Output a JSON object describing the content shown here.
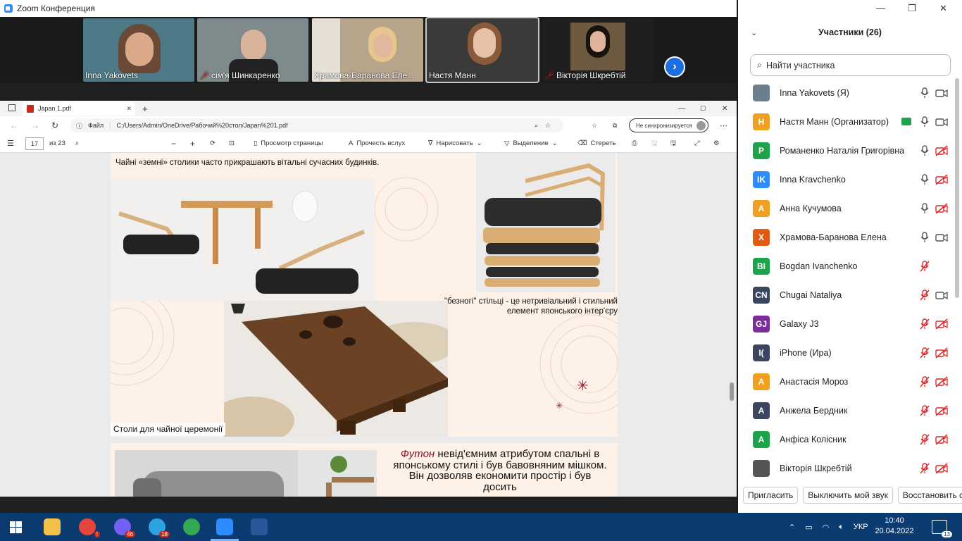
{
  "zoom_window": {
    "title": "Zoom Конференция"
  },
  "video_tiles": [
    {
      "name": "Inna Yakovets",
      "muted": false,
      "bg": "#4d7a86"
    },
    {
      "name": "сім'я Шинкаренко",
      "muted": true,
      "bg": "#7f8a8c"
    },
    {
      "name": "Храмова-Баранова Еле...",
      "muted": false,
      "bg": "#b7a58b"
    },
    {
      "name": "Настя Манн",
      "muted": false,
      "bg": "#3b3a38"
    },
    {
      "name": "Вікторія Шкребтій",
      "muted": true,
      "bg": "#1f1f1f"
    }
  ],
  "browser": {
    "tab_title": "Japan 1.pdf",
    "address_label": "Файл",
    "address": "C:/Users/Admin/OneDrive/Рабочий%20стол/Japan%201.pdf",
    "sync_label": "Не синхронизируется",
    "toolbar": {
      "page_current": "17",
      "page_total": "из 23",
      "page_view": "Просмотр страницы",
      "read_aloud": "Прочесть вслух",
      "draw": "Нарисовать",
      "highlight": "Выделение",
      "erase": "Стереть"
    }
  },
  "pdf": {
    "caption_top": "Чайні «земні» столики часто прикрашають вітальні сучасних будинків.",
    "caption_right": "\"безногі\" стільці - це нетривіальний і стильний елемент японського інтер'єру",
    "caption_bottom": "Столи для чайної церемонії",
    "futon_word": "Футон",
    "futon_text": " невід'ємним атрибутом спальні в японському стилі і був бавовняним мішком. Він дозволяв економити простір і був досить"
  },
  "participants_panel": {
    "title": "Участники (26)",
    "search_placeholder": "Найти участника",
    "participants": [
      {
        "initials": "",
        "name": "Inna Yakovets (Я)",
        "color": "#6d7f8c",
        "mic": "on",
        "cam": "on"
      },
      {
        "initials": "Н",
        "name": "Настя Манн (Организатор)",
        "color": "#f0a020",
        "mic": "on",
        "cam": "on"
      },
      {
        "initials": "Р",
        "name": "Романенко Наталія Григорівна",
        "color": "#1da34b",
        "mic": "on",
        "cam": "off"
      },
      {
        "initials": "IK",
        "name": "Inna Kravchenko",
        "color": "#2d8cff",
        "mic": "on",
        "cam": "off"
      },
      {
        "initials": "А",
        "name": "Анна Кучумова",
        "color": "#f0a020",
        "mic": "on",
        "cam": "off"
      },
      {
        "initials": "Х",
        "name": "Храмова-Баранова Елена",
        "color": "#e05a10",
        "mic": "on",
        "cam": "on"
      },
      {
        "initials": "BI",
        "name": "Bogdan Ivanchenko",
        "color": "#1da34b",
        "mic": "off",
        "cam": "none"
      },
      {
        "initials": "CN",
        "name": "Chugai Nataliya",
        "color": "#3a4660",
        "mic": "off",
        "cam": "on"
      },
      {
        "initials": "GJ",
        "name": "Galaxy J3",
        "color": "#7a2e9a",
        "mic": "off",
        "cam": "off"
      },
      {
        "initials": "I(",
        "name": "iPhone (Ира)",
        "color": "#3a4660",
        "mic": "off",
        "cam": "off"
      },
      {
        "initials": "А",
        "name": "Анастасія Мороз",
        "color": "#f0a020",
        "mic": "off",
        "cam": "off"
      },
      {
        "initials": "А",
        "name": "Анжела Бердник",
        "color": "#3a4660",
        "mic": "off",
        "cam": "off"
      },
      {
        "initials": "А",
        "name": "Анфіса Колісник",
        "color": "#1da34b",
        "mic": "off",
        "cam": "off"
      },
      {
        "initials": "",
        "name": "Вікторія Шкребтій",
        "color": "#555555",
        "mic": "off",
        "cam": "off"
      }
    ],
    "footer": {
      "invite": "Пригласить",
      "mute": "Выключить мой звук",
      "restore": "Восстановить стат"
    }
  },
  "taskbar": {
    "time": "10:40",
    "date": "20.04.2022",
    "lang": "УКР",
    "notifications": "13",
    "badge_viber": "46",
    "badge_telegram": "18"
  },
  "colors": {
    "accent": "#2d8cff",
    "taskbar": "#0b3b70",
    "muted": "#e02828"
  }
}
